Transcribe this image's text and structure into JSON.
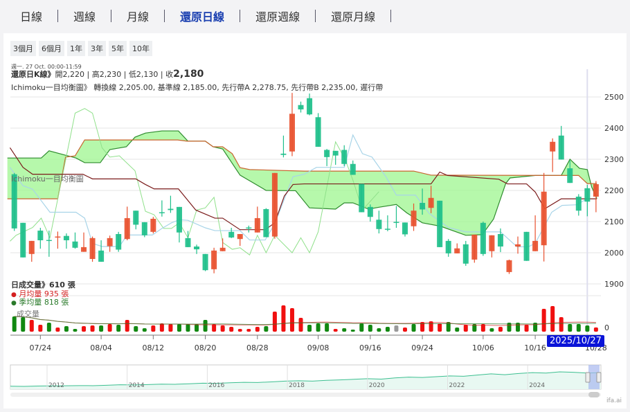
{
  "tabs": [
    {
      "label": "日線",
      "active": false
    },
    {
      "label": "週線",
      "active": false
    },
    {
      "label": "月線",
      "active": false
    },
    {
      "label": "還原日線",
      "active": true
    },
    {
      "label": "還原週線",
      "active": false
    },
    {
      "label": "還原月線",
      "active": false
    }
  ],
  "ranges": [
    "3個月",
    "6個月",
    "1年",
    "3年",
    "5年",
    "10年"
  ],
  "info": {
    "datetime": "週一. 27 Oct. 00:00-11:59",
    "k_label": "還原日K線》",
    "open": "開2,220",
    "high": "高2,230",
    "low": "低2,130",
    "close_label": "收",
    "close": "2,180",
    "ichimoku": "Ichimoku一目均衡圖》 轉換線 2,205.00, 基準線 2,185.00, 先行帶A 2,278.75, 先行帶B 2,235.00, 遲行帶",
    "ichimoku_series_label": "Ichimoku一目均衡圖"
  },
  "volume_info": {
    "daily": "日成交量》610 張",
    "monthly": "月均量 935 張",
    "quarterly": "季均量 818 張",
    "series_label": "成交量",
    "zero_label": "0"
  },
  "tooltip": "2025/10/27",
  "watermark": "ifa.ai",
  "colors": {
    "up": "#e8502e",
    "down": "#1dbf8a",
    "vol_red": "#f01010",
    "vol_green": "#118811",
    "cloud": "#9ef58f",
    "accent": "#1a3fb0"
  },
  "chart_data": {
    "type": "candlestick",
    "y_ticks": [
      2500,
      2400,
      2300,
      2200,
      2100,
      2000,
      1900
    ],
    "ylim": [
      1900,
      2500
    ],
    "x_ticks": [
      {
        "i": 3,
        "label": "07/24"
      },
      {
        "i": 10,
        "label": "08/04"
      },
      {
        "i": 16,
        "label": "08/12"
      },
      {
        "i": 22,
        "label": "08/20"
      },
      {
        "i": 28,
        "label": "08/28"
      },
      {
        "i": 35,
        "label": "09/08"
      },
      {
        "i": 41,
        "label": "09/16"
      },
      {
        "i": 47,
        "label": "09/24"
      },
      {
        "i": 54,
        "label": "10/06"
      },
      {
        "i": 60,
        "label": "10/16"
      },
      {
        "i": 67,
        "label": "10/28"
      }
    ],
    "candles": [
      [
        2078,
        2256,
        2070,
        2252,
        "g"
      ],
      [
        1985,
        2096,
        1985,
        2096,
        "g"
      ],
      [
        2038,
        2038,
        1971,
        1996,
        "r"
      ],
      [
        2040,
        2080,
        2013,
        2071,
        "g"
      ],
      [
        2038,
        2071,
        1987,
        2041,
        "g"
      ],
      [
        2052,
        2068,
        2013,
        2049,
        "r"
      ],
      [
        2040,
        2062,
        2013,
        2054,
        "g"
      ],
      [
        2016,
        2065,
        2013,
        2036,
        "g"
      ],
      [
        2018,
        2065,
        2003,
        2003,
        "r"
      ],
      [
        2047,
        2052,
        1971,
        1980,
        "r"
      ],
      [
        1971,
        2040,
        1971,
        2007,
        "g"
      ],
      [
        2047,
        2055,
        2003,
        2021,
        "r"
      ],
      [
        2010,
        2067,
        2003,
        2060,
        "g"
      ],
      [
        2111,
        2148,
        2040,
        2044,
        "r"
      ],
      [
        2090,
        2135,
        2075,
        2135,
        "g"
      ],
      [
        2056,
        2098,
        2050,
        2098,
        "g"
      ],
      [
        2109,
        2115,
        2062,
        2067,
        "r"
      ],
      [
        2127,
        2168,
        2116,
        2130,
        "g"
      ],
      [
        2137,
        2183,
        2128,
        2141,
        "g"
      ],
      [
        2065,
        2147,
        2033,
        2147,
        "g"
      ],
      [
        2018,
        2070,
        2018,
        2047,
        "g"
      ],
      [
        2011,
        2026,
        1996,
        2020,
        "g"
      ],
      [
        1944,
        1996,
        1941,
        1996,
        "g"
      ],
      [
        2007,
        2016,
        1934,
        1947,
        "r"
      ],
      [
        2016,
        2046,
        2005,
        2005,
        "r"
      ],
      [
        2049,
        2080,
        2047,
        2067,
        "g"
      ],
      [
        2060,
        2060,
        2022,
        2044,
        "r"
      ],
      [
        2079,
        2087,
        2065,
        2081,
        "g"
      ],
      [
        2111,
        2148,
        2065,
        2065,
        "r"
      ],
      [
        2050,
        2143,
        2050,
        2140,
        "g"
      ],
      [
        2256,
        2256,
        2045,
        2052,
        "r"
      ],
      [
        2314,
        2376,
        2306,
        2318,
        "g"
      ],
      [
        2446,
        2513,
        2310,
        2325,
        "r"
      ],
      [
        2460,
        2485,
        2450,
        2474,
        "g"
      ],
      [
        2444,
        2511,
        2441,
        2496,
        "g"
      ],
      [
        2340,
        2448,
        2340,
        2435,
        "g"
      ],
      [
        2307,
        2333,
        2278,
        2330,
        "g"
      ],
      [
        2312,
        2327,
        2282,
        2327,
        "g"
      ],
      [
        2285,
        2345,
        2278,
        2330,
        "g"
      ],
      [
        2250,
        2296,
        2250,
        2285,
        "g"
      ],
      [
        2130,
        2221,
        2130,
        2221,
        "g"
      ],
      [
        2115,
        2155,
        2100,
        2147,
        "g"
      ],
      [
        2076,
        2135,
        2062,
        2106,
        "g"
      ],
      [
        2074,
        2120,
        2069,
        2077,
        "g"
      ],
      [
        2096,
        2150,
        2080,
        2099,
        "g"
      ],
      [
        2059,
        2097,
        2052,
        2097,
        "g"
      ],
      [
        2135,
        2158,
        2070,
        2085,
        "r"
      ],
      [
        2139,
        2206,
        2122,
        2160,
        "g"
      ],
      [
        2176,
        2215,
        2127,
        2144,
        "r"
      ],
      [
        2018,
        2167,
        2018,
        2167,
        "g"
      ],
      [
        1998,
        2044,
        1987,
        2038,
        "g"
      ],
      [
        2014,
        2030,
        1998,
        1998,
        "r"
      ],
      [
        1965,
        2038,
        1958,
        2027,
        "g"
      ],
      [
        2058,
        2058,
        1968,
        1978,
        "r"
      ],
      [
        1996,
        2100,
        1990,
        2096,
        "g"
      ],
      [
        2056,
        2056,
        1985,
        2005,
        "r"
      ],
      [
        2020,
        2078,
        2002,
        2060,
        "g"
      ],
      [
        1976,
        1978,
        1932,
        1938,
        "r"
      ],
      [
        2027,
        2052,
        1997,
        2020,
        "r"
      ],
      [
        1974,
        2067,
        1974,
        2067,
        "g"
      ],
      [
        2038,
        2120,
        2005,
        2005,
        "r"
      ],
      [
        2196,
        2256,
        1972,
        2024,
        "r"
      ],
      [
        2356,
        2367,
        2259,
        2325,
        "r"
      ],
      [
        2299,
        2407,
        2299,
        2376,
        "g"
      ],
      [
        2224,
        2296,
        2224,
        2271,
        "g"
      ],
      [
        2135,
        2188,
        2119,
        2180,
        "g"
      ],
      [
        2164,
        2218,
        2117,
        2207,
        "g"
      ],
      [
        2220,
        2230,
        2130,
        2180,
        "r"
      ]
    ],
    "senkou_a": [
      [
        -0.8,
        2304
      ],
      [
        3.1,
        2304
      ],
      [
        4,
        2327
      ],
      [
        7.1,
        2304
      ],
      [
        8.1,
        2289
      ],
      [
        9.9,
        2289
      ],
      [
        11,
        2331
      ],
      [
        12.9,
        2340
      ],
      [
        13.9,
        2371
      ],
      [
        15.1,
        2384
      ],
      [
        17,
        2391
      ],
      [
        18.9,
        2391
      ],
      [
        20,
        2358
      ],
      [
        22,
        2358
      ],
      [
        22.9,
        2340
      ],
      [
        24,
        2333
      ],
      [
        26,
        2249
      ],
      [
        29,
        2200
      ],
      [
        32.4,
        2199
      ],
      [
        34,
        2144
      ],
      [
        37,
        2140
      ],
      [
        38,
        2160
      ],
      [
        39,
        2160
      ],
      [
        40.8,
        2140
      ],
      [
        42,
        2146
      ],
      [
        44,
        2155
      ],
      [
        45.2,
        2128
      ],
      [
        47,
        2096
      ],
      [
        49.1,
        2085
      ],
      [
        52,
        2056
      ],
      [
        53.9,
        2058
      ],
      [
        55.2,
        2108
      ],
      [
        56.6,
        2222
      ],
      [
        57.1,
        2240
      ],
      [
        60,
        2248
      ],
      [
        63,
        2248
      ],
      [
        64,
        2300
      ],
      [
        65.1,
        2271
      ],
      [
        66,
        2267
      ],
      [
        66.5,
        2211
      ],
      [
        67.1,
        2174
      ]
    ],
    "senkou_b": [
      [
        -0.8,
        2173
      ],
      [
        5,
        2173
      ],
      [
        5.9,
        2307
      ],
      [
        7,
        2311
      ],
      [
        8.1,
        2362
      ],
      [
        18.8,
        2362
      ],
      [
        19.9,
        2358
      ],
      [
        22,
        2358
      ],
      [
        22.9,
        2340
      ],
      [
        24,
        2340
      ],
      [
        25.1,
        2318
      ],
      [
        26,
        2273
      ],
      [
        27.1,
        2267
      ],
      [
        33.4,
        2262
      ],
      [
        46,
        2262
      ],
      [
        48,
        2249
      ],
      [
        65,
        2248
      ],
      [
        66,
        2222
      ],
      [
        67.1,
        2222
      ]
    ],
    "kijun": [
      [
        -0.5,
        2337
      ],
      [
        1,
        2274
      ],
      [
        2.1,
        2252
      ],
      [
        7.9,
        2252
      ],
      [
        9,
        2237
      ],
      [
        14,
        2237
      ],
      [
        15.1,
        2219
      ],
      [
        16.1,
        2205
      ],
      [
        18.9,
        2205
      ],
      [
        20.9,
        2137
      ],
      [
        23.1,
        2111
      ],
      [
        24,
        2111
      ],
      [
        26,
        2074
      ],
      [
        28.9,
        2074
      ],
      [
        30,
        2096
      ],
      [
        31.1,
        2182
      ],
      [
        32.1,
        2219
      ],
      [
        33.4,
        2221
      ],
      [
        48,
        2221
      ],
      [
        49,
        2259
      ],
      [
        49.9,
        2248
      ],
      [
        55.8,
        2236
      ],
      [
        56.8,
        2221
      ],
      [
        59,
        2221
      ],
      [
        60,
        2195
      ],
      [
        61.1,
        2141
      ],
      [
        63,
        2173
      ],
      [
        67.1,
        2173
      ]
    ],
    "tenkan": [
      [
        -0.5,
        2274
      ],
      [
        1,
        2215
      ],
      [
        2.1,
        2204
      ],
      [
        4.1,
        2130
      ],
      [
        7.1,
        2130
      ],
      [
        8.1,
        2111
      ],
      [
        9,
        2030
      ],
      [
        10.1,
        2020
      ],
      [
        12.1,
        2020
      ],
      [
        13,
        2057
      ],
      [
        15.9,
        2057
      ],
      [
        17,
        2078
      ],
      [
        18.1,
        2096
      ],
      [
        19,
        2106
      ],
      [
        20,
        2104
      ],
      [
        22,
        2080
      ],
      [
        23.1,
        2071
      ],
      [
        26,
        2071
      ],
      [
        27.1,
        2041
      ],
      [
        28.9,
        2041
      ],
      [
        30,
        2093
      ],
      [
        32.1,
        2244
      ],
      [
        33.4,
        2252
      ],
      [
        34.8,
        2274
      ],
      [
        38,
        2274
      ],
      [
        39,
        2378
      ],
      [
        40.1,
        2318
      ],
      [
        41.2,
        2307
      ],
      [
        42.8,
        2244
      ],
      [
        44,
        2185
      ],
      [
        46.2,
        2185
      ],
      [
        47.8,
        2126
      ],
      [
        50,
        2081
      ],
      [
        52,
        2067
      ],
      [
        56,
        2067
      ],
      [
        57.9,
        2019
      ],
      [
        59.2,
        2019
      ],
      [
        60,
        2030
      ],
      [
        61.9,
        2130
      ],
      [
        63.1,
        2152
      ],
      [
        64.8,
        2154
      ],
      [
        66,
        2174
      ]
    ],
    "chikou": [
      [
        -0.5,
        2037
      ],
      [
        0.2,
        2056
      ],
      [
        2.1,
        2081
      ],
      [
        3.1,
        2111
      ],
      [
        4.1,
        2048
      ],
      [
        7,
        2448
      ],
      [
        8.1,
        2463
      ],
      [
        9,
        2448
      ],
      [
        10.1,
        2337
      ],
      [
        11,
        2307
      ],
      [
        12.1,
        2311
      ],
      [
        13.9,
        2263
      ],
      [
        15.1,
        2133
      ],
      [
        16.1,
        2122
      ],
      [
        17.2,
        2078
      ],
      [
        18.1,
        2078
      ],
      [
        19,
        2096
      ],
      [
        20,
        2048
      ],
      [
        21,
        2137
      ],
      [
        22,
        2144
      ],
      [
        23,
        2178
      ],
      [
        24,
        2033
      ],
      [
        25.1,
        2011
      ],
      [
        26,
        2016
      ],
      [
        27.1,
        1993
      ],
      [
        28,
        2056
      ],
      [
        29,
        2000
      ],
      [
        30,
        2056
      ],
      [
        32,
        2000
      ],
      [
        33,
        2048
      ],
      [
        34,
        2000
      ],
      [
        35,
        2067
      ],
      [
        37,
        2356
      ],
      [
        38.1,
        2300
      ],
      [
        39,
        2233
      ],
      [
        40.1,
        2137
      ],
      [
        42,
        2196
      ]
    ],
    "volume": [
      2200,
      2100,
      1700,
      1000,
      1300,
      600,
      800,
      400,
      800,
      900,
      900,
      1100,
      1000,
      1700,
      800,
      500,
      900,
      1200,
      1100,
      1100,
      1100,
      1100,
      1700,
      1100,
      900,
      700,
      400,
      400,
      700,
      800,
      2900,
      3800,
      3400,
      2000,
      1000,
      1200,
      1200,
      400,
      500,
      300,
      1200,
      1000,
      500,
      700,
      900,
      600,
      1100,
      1400,
      1500,
      1200,
      1400,
      600,
      1000,
      1100,
      1100,
      500,
      700,
      1300,
      1300,
      1000,
      1300,
      3300,
      3700,
      2100,
      1100,
      1100,
      900,
      610
    ],
    "volume_colors": "ggrrgrggrrgrgrggrrrggggrrrrrrgrrrrgggrggggggxrgrrrggrgrgrggrgrrrgggrr",
    "navigator": {
      "years": [
        "2012",
        "2014",
        "2016",
        "2018",
        "2020",
        "2022",
        "2024"
      ],
      "series": [
        520,
        500,
        540,
        560,
        580,
        600,
        590,
        640,
        700,
        680,
        720,
        780,
        760,
        820,
        900,
        880,
        950,
        1000,
        980,
        1060,
        1150,
        1200,
        1150,
        1250,
        1300,
        1380,
        1450,
        1400,
        1550,
        1650,
        1600,
        1700,
        1800,
        1750,
        1900,
        2050,
        1950,
        2100,
        2200,
        2150,
        2300,
        2250,
        2150,
        2200
      ]
    }
  }
}
